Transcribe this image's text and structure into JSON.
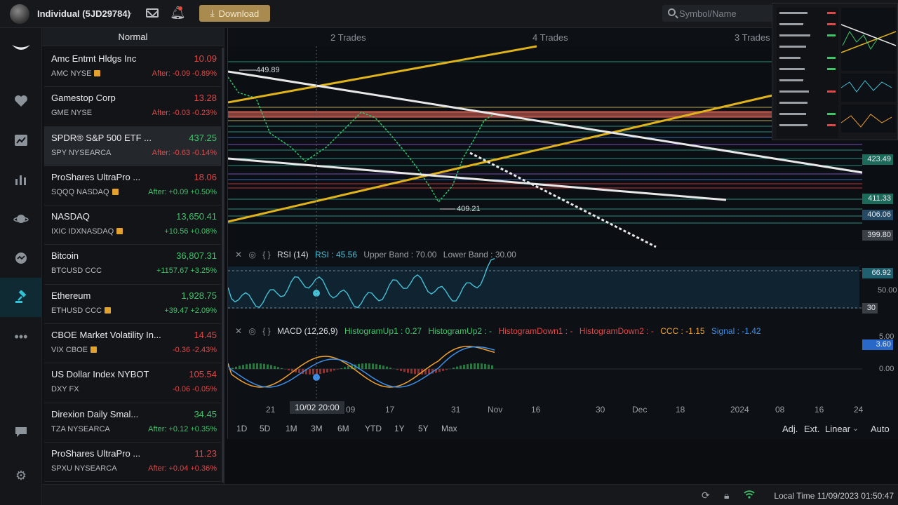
{
  "account": {
    "name": "Individual (5JD29784)"
  },
  "header": {
    "download_label": "Download"
  },
  "search": {
    "placeholder": "Symbol/Name"
  },
  "watchlist": {
    "tab_label": "Normal",
    "items": [
      {
        "name": "Amc Entmt Hldgs Inc",
        "price": "10.09",
        "sub": "AMC NYSE",
        "ext": true,
        "change": "After: -0.09 -0.89%",
        "price_color": "#e04848",
        "change_color": "#e04848"
      },
      {
        "name": "Gamestop Corp",
        "price": "13.28",
        "sub": "GME NYSE",
        "ext": false,
        "change": "After: -0.03 -0.23%",
        "price_color": "#e04848",
        "change_color": "#e04848"
      },
      {
        "name": "SPDR® S&P 500 ETF ...",
        "price": "437.25",
        "sub": "SPY NYSEARCA",
        "ext": false,
        "change": "After: -0.63 -0.14%",
        "price_color": "#3fc46a",
        "change_color": "#e04848"
      },
      {
        "name": "ProShares UltraPro ...",
        "price": "18.06",
        "sub": "SQQQ NASDAQ",
        "ext": true,
        "change": "After: +0.09 +0.50%",
        "price_color": "#e04848",
        "change_color": "#3fc46a"
      },
      {
        "name": "NASDAQ",
        "price": "13,650.41",
        "sub": "IXIC IDXNASDAQ",
        "ext": true,
        "change": "+10.56 +0.08%",
        "price_color": "#3fc46a",
        "change_color": "#3fc46a"
      },
      {
        "name": "Bitcoin",
        "price": "36,807.31",
        "sub": "BTCUSD CCC",
        "ext": false,
        "change": "+1157.67 +3.25%",
        "price_color": "#3fc46a",
        "change_color": "#3fc46a"
      },
      {
        "name": "Ethereum",
        "price": "1,928.75",
        "sub": "ETHUSD CCC",
        "ext": true,
        "change": "+39.47 +2.09%",
        "price_color": "#3fc46a",
        "change_color": "#3fc46a"
      },
      {
        "name": "CBOE Market Volatility In...",
        "price": "14.45",
        "sub": "VIX CBOE",
        "ext": true,
        "change": "-0.36 -2.43%",
        "price_color": "#e04848",
        "change_color": "#e04848"
      },
      {
        "name": "US Dollar Index NYBOT",
        "price": "105.54",
        "sub": "DXY FX",
        "ext": false,
        "change": "-0.06 -0.05%",
        "price_color": "#e04848",
        "change_color": "#e04848"
      },
      {
        "name": "Direxion Daily Smal...",
        "price": "34.45",
        "sub": "TZA NYSEARCA",
        "ext": false,
        "change": "After: +0.12 +0.35%",
        "price_color": "#3fc46a",
        "change_color": "#3fc46a"
      },
      {
        "name": "ProShares UltraPro ...",
        "price": "11.23",
        "sub": "SPXU NYSEARCA",
        "ext": false,
        "change": "After: +0.04 +0.36%",
        "price_color": "#e04848",
        "change_color": "#e04848"
      }
    ]
  },
  "chart": {
    "trades_labels": [
      "2 Trades",
      "4 Trades",
      "3 Trades"
    ],
    "annotations": {
      "high": "449.89",
      "low": "409.21"
    },
    "price_tags": [
      {
        "value": "423.49",
        "color": "#1c6a5a"
      },
      {
        "value": "411.33",
        "color": "#1c6a5a"
      },
      {
        "value": "406.06",
        "color": "#244a66"
      },
      {
        "value": "399.80",
        "color": "#3a3f45"
      }
    ],
    "rsi": {
      "name": "RSI (14)",
      "value": "RSI : 45.56",
      "upper": "Upper Band : 70.00",
      "lower": "Lower Band : 30.00",
      "tag_high": "66.92",
      "mid": "50.00",
      "tag_low": "30"
    },
    "macd": {
      "name": "MACD (12,26,9)",
      "hist_up1": "HistogramUp1 : 0.27",
      "hist_up2": "HistogramUp2 : -",
      "hist_down1": "HistogramDown1 : -",
      "hist_down2": "HistogramDown2 : -",
      "ccc": "CCC : -1.15",
      "signal": "Signal : -1.42",
      "axis_high": "5.00",
      "tag": "3.60",
      "axis_zero": "0.00"
    },
    "x_axis": [
      "21",
      "09",
      "17",
      "31",
      "Nov",
      "16",
      "30",
      "Dec",
      "18",
      "2024",
      "08",
      "16",
      "24"
    ],
    "crosshair_time": "10/02 20:00",
    "ranges": [
      "1D",
      "5D",
      "1M",
      "3M",
      "6M",
      "YTD",
      "1Y",
      "5Y",
      "Max"
    ],
    "controls": {
      "adj": "Adj.",
      "ext": "Ext.",
      "scale": "Linear",
      "auto": "Auto"
    }
  },
  "status": {
    "local_time": "Local Time 11/09/2023 01:50:47"
  }
}
